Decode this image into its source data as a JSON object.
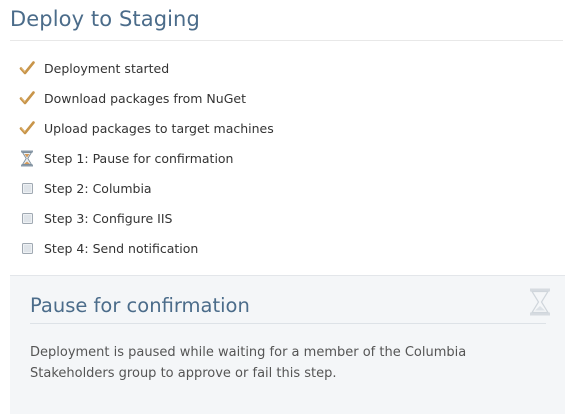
{
  "page": {
    "title": "Deploy to Staging"
  },
  "steps": [
    {
      "label": "Deployment started",
      "status": "complete",
      "icon": "checkmark-icon"
    },
    {
      "label": "Download packages from NuGet",
      "status": "complete",
      "icon": "checkmark-icon"
    },
    {
      "label": "Upload packages to target machines",
      "status": "complete",
      "icon": "checkmark-icon"
    },
    {
      "label": "Step 1: Pause for confirmation",
      "status": "waiting",
      "icon": "hourglass-icon"
    },
    {
      "label": "Step 2: Columbia",
      "status": "pending",
      "icon": "checkbox-icon"
    },
    {
      "label": "Step 3: Configure IIS",
      "status": "pending",
      "icon": "checkbox-icon"
    },
    {
      "label": "Step 4: Send notification",
      "status": "pending",
      "icon": "checkbox-icon"
    }
  ],
  "pause_panel": {
    "title": "Pause for confirmation",
    "message": "Deployment is paused while waiting for a member of the Columbia Stakeholders group to approve or fail this step.",
    "icon": "hourglass-icon"
  },
  "colors": {
    "heading": "#4b6c8a",
    "check": "#c8954a",
    "panel_bg": "#f4f6f8"
  }
}
